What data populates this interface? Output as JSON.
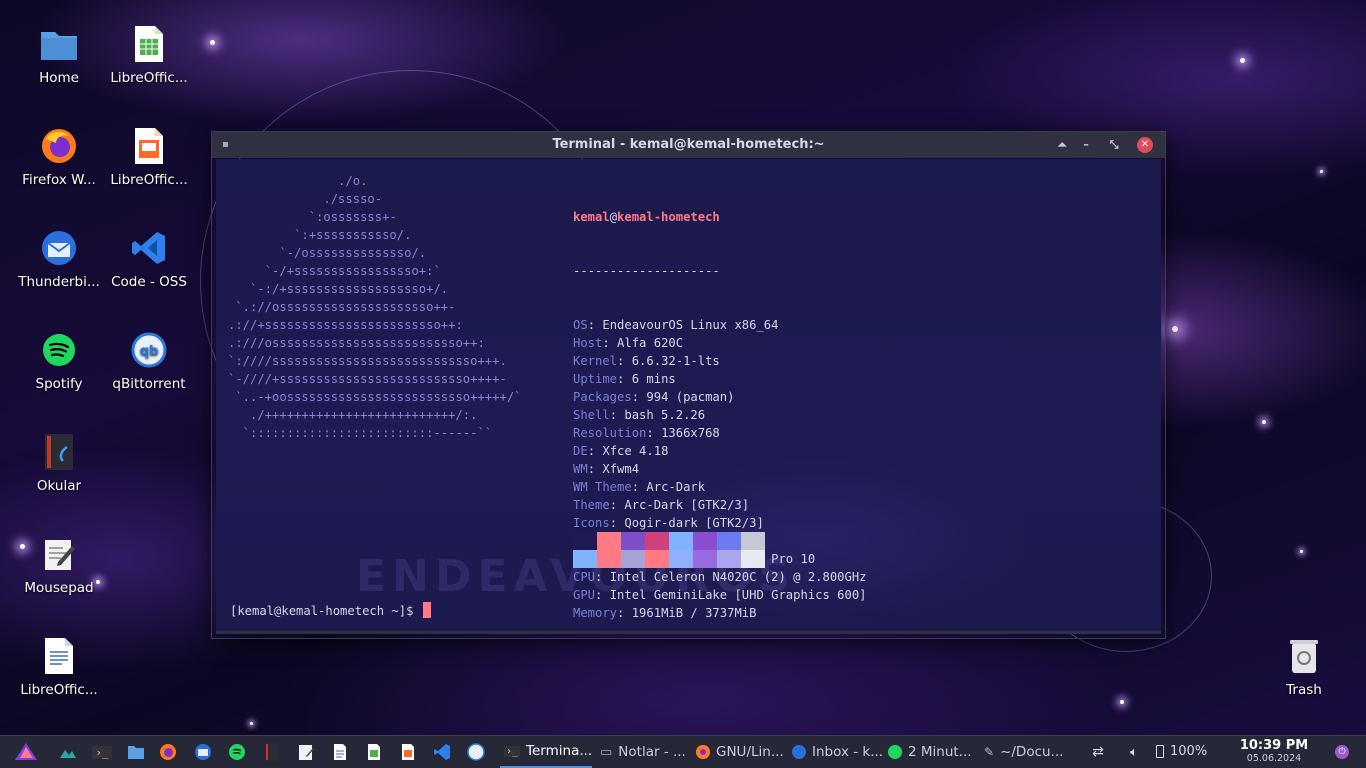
{
  "desktop": {
    "icons": [
      {
        "label": "Home",
        "icon": "folder-icon"
      },
      {
        "label": "LibreOffic...",
        "icon": "calc-icon"
      },
      {
        "label": "Firefox W...",
        "icon": "firefox-icon"
      },
      {
        "label": "LibreOffic...",
        "icon": "impress-icon"
      },
      {
        "label": "Thunderbi...",
        "icon": "thunderbird-icon"
      },
      {
        "label": "Code - OSS",
        "icon": "vscode-icon"
      },
      {
        "label": "Spotify",
        "icon": "spotify-icon"
      },
      {
        "label": "qBittorrent",
        "icon": "qbittorrent-icon"
      },
      {
        "label": "Okular",
        "icon": "okular-icon"
      },
      {
        "label": "Mousepad",
        "icon": "mousepad-icon"
      },
      {
        "label": "LibreOffic...",
        "icon": "writer-icon"
      },
      {
        "label": "Trash",
        "icon": "trash-icon"
      }
    ]
  },
  "terminal": {
    "title": "Terminal - kemal@kemal-hometech:~",
    "ascii": [
      "               ./o.",
      "             ./sssso-",
      "           `:osssssss+-",
      "         `:+sssssssssso/.",
      "       `-/ossssssssssssso/.",
      "     `-/+sssssssssssssssso+:`",
      "   `-:/+sssssssssssssssssso+/.",
      " `.://osssssssssssssssssssso++-",
      ".://+ssssssssssssssssssssssso++:",
      ".:///ossssssssssssssssssssssssso++:",
      "`:////ssssssssssssssssssssssssssso+++.",
      "`-////+ssssssssssssssssssssssssso++++-",
      " `..-+oosssssssssssssssssssssssso+++++/`",
      "   ./++++++++++++++++++++++++++/:.",
      "  `:::::::::::::::::::::::::------``"
    ],
    "user": "kemal",
    "host": "kemal-hometech",
    "separator": "--------------------",
    "info": [
      {
        "key": "OS",
        "value": "EndeavourOS Linux x86_64"
      },
      {
        "key": "Host",
        "value": "Alfa 620C"
      },
      {
        "key": "Kernel",
        "value": "6.6.32-1-lts"
      },
      {
        "key": "Uptime",
        "value": "6 mins"
      },
      {
        "key": "Packages",
        "value": "994 (pacman)"
      },
      {
        "key": "Shell",
        "value": "bash 5.2.26"
      },
      {
        "key": "Resolution",
        "value": "1366x768"
      },
      {
        "key": "DE",
        "value": "Xfce 4.18"
      },
      {
        "key": "WM",
        "value": "Xfwm4"
      },
      {
        "key": "WM Theme",
        "value": "Arc-Dark"
      },
      {
        "key": "Theme",
        "value": "Arc-Dark [GTK2/3]"
      },
      {
        "key": "Icons",
        "value": "Qogir-dark [GTK2/3]"
      },
      {
        "key": "Terminal",
        "value": "xfce4-terminal"
      },
      {
        "key": "Terminal Font",
        "value": "Source Code Pro 10"
      },
      {
        "key": "CPU",
        "value": "Intel Celeron N4020C (2) @ 2.800GHz"
      },
      {
        "key": "GPU",
        "value": "Intel GeminiLake [UHD Graphics 600]"
      },
      {
        "key": "Memory",
        "value": "1961MiB / 3737MiB"
      }
    ],
    "color_blocks_top": [
      "#1d1b52",
      "#ff7a85",
      "#7f4fc9",
      "#d0407a",
      "#7fb3ff",
      "#8a4fd0",
      "#6e7bf0",
      "#c7c8d6"
    ],
    "color_blocks_bottom": [
      "#7fb3ff",
      "#ff7a85",
      "#a7a3d8",
      "#ff7a85",
      "#8fb0ff",
      "#9a6ae0",
      "#a9a6ee",
      "#e7e8f0"
    ],
    "watermark": "ENDEAVOUROS",
    "prompt": "[kemal@kemal-hometech ~]$ "
  },
  "taskbar": {
    "tasks": [
      {
        "label": "Termina...",
        "icon": "terminal-icon",
        "active": true
      },
      {
        "label": "Notlar - ...",
        "icon": "folder-icon",
        "active": false
      },
      {
        "label": "GNU/Lin...",
        "icon": "firefox-icon",
        "active": false
      },
      {
        "label": "Inbox - k...",
        "icon": "thunderbird-icon",
        "active": false
      },
      {
        "label": "2 Minut...",
        "icon": "spotify-icon",
        "active": false
      },
      {
        "label": "~/Docu...",
        "icon": "mousepad-icon",
        "active": false
      }
    ],
    "volume": "100%",
    "battery": "100%",
    "time": "10:39 PM",
    "date": "05.06.2024"
  }
}
